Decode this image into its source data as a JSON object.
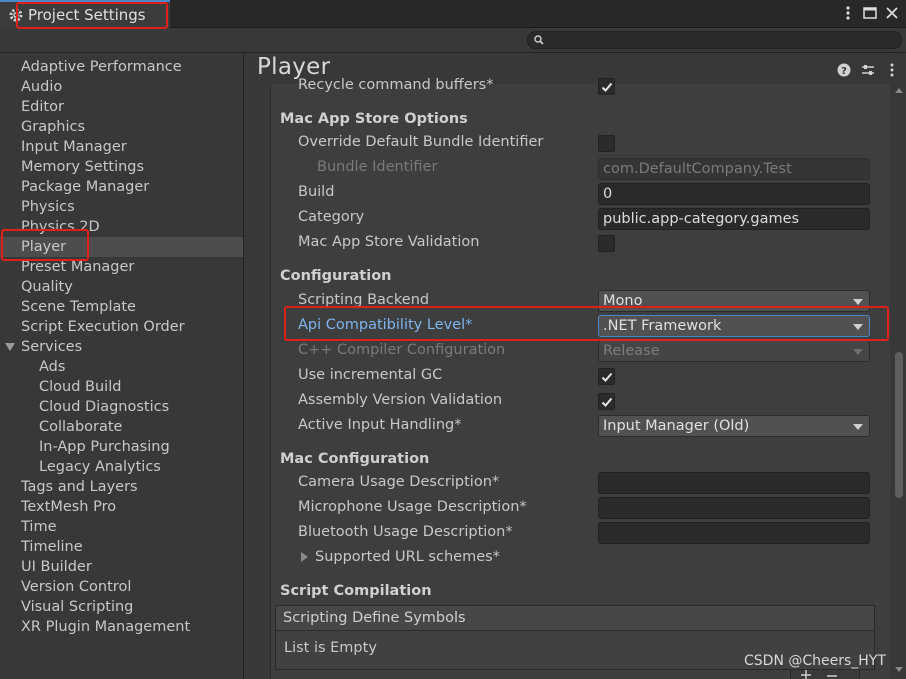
{
  "window": {
    "title": "Project Settings"
  },
  "search": {
    "placeholder": ""
  },
  "sidebar": {
    "items": [
      {
        "label": "Adaptive Performance"
      },
      {
        "label": "Audio"
      },
      {
        "label": "Editor"
      },
      {
        "label": "Graphics"
      },
      {
        "label": "Input Manager"
      },
      {
        "label": "Memory Settings"
      },
      {
        "label": "Package Manager"
      },
      {
        "label": "Physics"
      },
      {
        "label": "Physics 2D"
      },
      {
        "label": "Player",
        "selected": true
      },
      {
        "label": "Preset Manager"
      },
      {
        "label": "Quality"
      },
      {
        "label": "Scene Template"
      },
      {
        "label": "Script Execution Order"
      },
      {
        "label": "Services",
        "expanded": true
      },
      {
        "label": "Ads",
        "sub": true
      },
      {
        "label": "Cloud Build",
        "sub": true
      },
      {
        "label": "Cloud Diagnostics",
        "sub": true
      },
      {
        "label": "Collaborate",
        "sub": true
      },
      {
        "label": "In-App Purchasing",
        "sub": true
      },
      {
        "label": "Legacy Analytics",
        "sub": true
      },
      {
        "label": "Tags and Layers"
      },
      {
        "label": "TextMesh Pro"
      },
      {
        "label": "Time"
      },
      {
        "label": "Timeline"
      },
      {
        "label": "UI Builder"
      },
      {
        "label": "Version Control"
      },
      {
        "label": "Visual Scripting"
      },
      {
        "label": "XR Plugin Management"
      }
    ]
  },
  "main": {
    "title": "Player",
    "recycle": {
      "label": "Recycle command buffers*",
      "checked": true
    },
    "mac_app_store": {
      "heading": "Mac App Store Options",
      "override_bundle": {
        "label": "Override Default Bundle Identifier",
        "checked": false
      },
      "bundle_identifier": {
        "label": "Bundle Identifier",
        "value": "com.DefaultCompany.Test"
      },
      "build": {
        "label": "Build",
        "value": "0"
      },
      "category": {
        "label": "Category",
        "value": "public.app-category.games"
      },
      "validation": {
        "label": "Mac App Store Validation",
        "checked": false
      }
    },
    "configuration": {
      "heading": "Configuration",
      "scripting_backend": {
        "label": "Scripting Backend",
        "value": "Mono"
      },
      "api_compat": {
        "label": "Api Compatibility Level*",
        "value": ".NET Framework"
      },
      "cpp_compiler": {
        "label": "C++ Compiler Configuration",
        "value": "Release"
      },
      "incremental_gc": {
        "label": "Use incremental GC",
        "checked": true
      },
      "assembly_validation": {
        "label": "Assembly Version Validation",
        "checked": true
      },
      "input_handling": {
        "label": "Active Input Handling*",
        "value": "Input Manager (Old)"
      }
    },
    "mac_configuration": {
      "heading": "Mac Configuration",
      "camera": {
        "label": "Camera Usage Description*",
        "value": ""
      },
      "microphone": {
        "label": "Microphone Usage Description*",
        "value": ""
      },
      "bluetooth": {
        "label": "Bluetooth Usage Description*",
        "value": ""
      },
      "url_schemes": {
        "label": "Supported URL schemes*"
      }
    },
    "script_compilation": {
      "heading": "Script Compilation",
      "define_symbols": {
        "label": "Scripting Define Symbols",
        "empty_text": "List is Empty"
      }
    }
  },
  "watermark": "CSDN @Cheers_HYT",
  "colors": {
    "accent": "#4a87c9",
    "highlight_text": "#7fb5ef",
    "annotation_red": "#e0201a"
  }
}
